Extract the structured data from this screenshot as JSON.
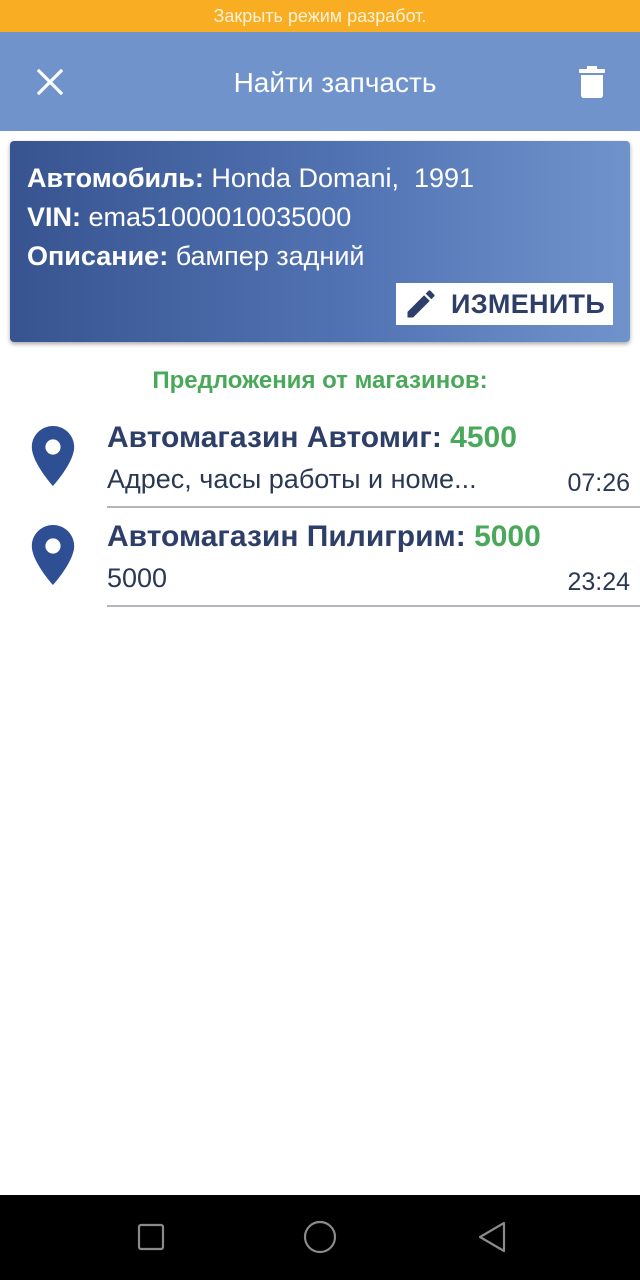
{
  "dev_banner": {
    "text": "Закрыть режим разработ."
  },
  "app_bar": {
    "title": "Найти запчасть",
    "close_icon": "close-icon",
    "delete_icon": "trash-icon"
  },
  "request": {
    "car_label": "Автомобиль:",
    "car_value": " Honda Domani,  1991",
    "vin_label": "VIN:",
    "vin_value": " ema51000010035000",
    "desc_label": "Описание:",
    "desc_value": " бампер задний",
    "edit_label": "ИЗМЕНИТЬ",
    "edit_icon": "pencil-icon"
  },
  "offers_heading": "Предложения от магазинов:",
  "offers": [
    {
      "shop": "Автомагазин Автомиг: ",
      "price": "4500",
      "subtitle": "Адрес, часы работы и номе...",
      "time": "07:26",
      "icon": "location-pin-icon"
    },
    {
      "shop": "Автомагазин Пилигрим: ",
      "price": "5000",
      "subtitle": "5000",
      "time": "23:24",
      "icon": "location-pin-icon"
    }
  ],
  "colors": {
    "banner": "#f9ad22",
    "app_bar": "#7093cc",
    "card_dark": "#375490",
    "accent_green": "#4aa85a",
    "text_dark": "#2d3f69"
  },
  "nav": {
    "icons": [
      "recent-apps-icon",
      "home-icon",
      "back-icon"
    ]
  }
}
